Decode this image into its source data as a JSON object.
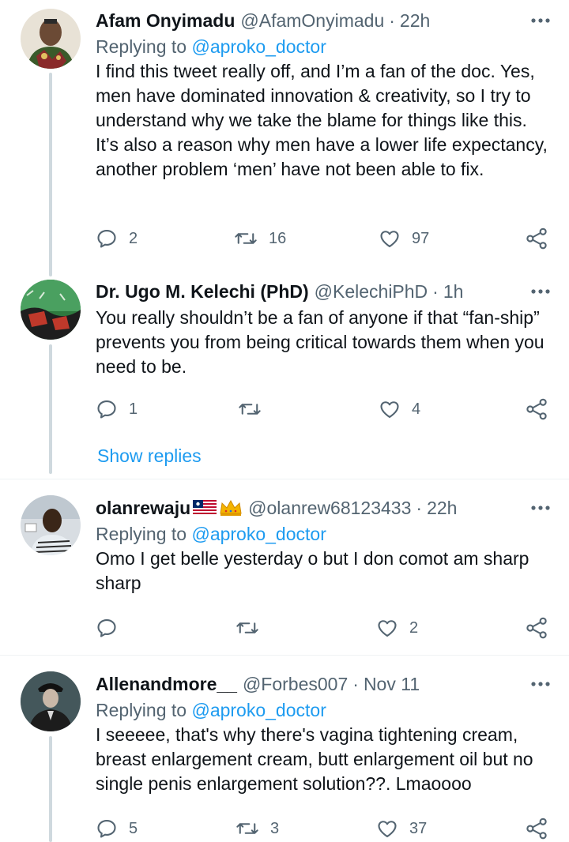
{
  "tweets": [
    {
      "name": "Afam Onyimadu",
      "handle": "@AfamOnyimadu",
      "time": "22h",
      "replying_label": "Replying to",
      "replying_to": "@aproko_doctor",
      "text": "I find this tweet really off, and I’m a fan of the doc. Yes, men have dominated innovation & creativity, so I try to understand why we take the blame for things like this. It’s also a reason why men have a lower life expectancy, another problem ‘men’ have not been able to fix.",
      "replies": "2",
      "retweets": "16",
      "likes": "97"
    },
    {
      "name": "Dr. Ugo M. Kelechi (PhD)",
      "handle": "@KelechiPhD",
      "time": "1h",
      "text": "You really shouldn’t be a fan of anyone if that “fan-ship” prevents you from being critical towards them when you need to be.",
      "replies": "1",
      "retweets": "",
      "likes": "4"
    },
    {
      "name": "olanrewaju",
      "name_emoji": "🇱🇷👑",
      "handle": "@olanrew68123433",
      "time": "22h",
      "replying_label": "Replying to",
      "replying_to": "@aproko_doctor",
      "text": "Omo I get belle yesterday o but I don comot am sharp sharp",
      "replies": "",
      "retweets": "",
      "likes": "2"
    },
    {
      "name": "Allenandmore__",
      "handle": "@Forbes007",
      "time": "Nov 11",
      "replying_label": "Replying to",
      "replying_to": "@aproko_doctor",
      "text": "I seeeee, that's why there's vagina tightening cream, breast enlargement cream, butt enlargement oil but no single penis enlargement solution??. Lmaoooo",
      "replies": "5",
      "retweets": "3",
      "likes": "37"
    }
  ],
  "show_replies_label": "Show replies",
  "colors": {
    "accent": "#1d9bf0",
    "secondary_text": "#536471",
    "primary_text": "#0f1419",
    "thread_line": "#cfd9de",
    "divider": "#eff3f4"
  },
  "icons": [
    "more-icon",
    "reply-icon",
    "retweet-icon",
    "like-icon",
    "share-icon"
  ]
}
